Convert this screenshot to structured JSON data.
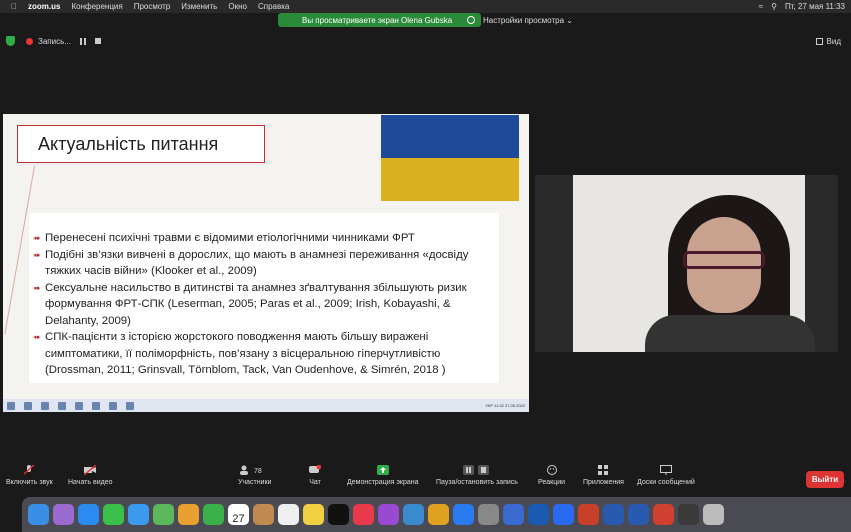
{
  "menubar": {
    "app": "zoom.us",
    "items": [
      "Конференция",
      "Просмотр",
      "Изменить",
      "Окно",
      "Справка"
    ],
    "datetime": "Пт, 27 мая  11:33"
  },
  "share_banner": {
    "text": "Вы просматриваете экран Olena Gubska",
    "view_settings": "Настройки просмотра"
  },
  "recording": {
    "label": "Запись..."
  },
  "view": {
    "label": "Вид"
  },
  "slide": {
    "title": "Актуальність питання",
    "bullets": [
      "Перенесені психічні травми є відомими етіологічними чинниками ФРТ",
      "Подібні зв’язки вивчені в дорослих, що мають в анамнезі переживання «досвіду тяжких часів війни» (Klooker et al., 2009)",
      "Сексуальне насильство в дитинстві та анамнез зґвалтування збільшують ризик формування ФРТ-СПК (Leserman, 2005; Paras et al., 2009; Irish, Kobayashi, & Delahanty, 2009)",
      "СПК-пацієнти з історією жорстокого поводження мають більшу виражені симптоматики, її поліморфність, пов’язану з  вісцеральною гіперчутливістю (Drossman, 2011; Grinsvall, Törnblom, Tack, Van Oudenhove, & Simrén, 2018 )"
    ],
    "taskbar_time": "11:32",
    "taskbar_date": "27.05.2022",
    "taskbar_lang": "УКР"
  },
  "controls": {
    "mute": "Включить звук",
    "video": "Начать видео",
    "participants": "Участники",
    "participants_count": "78",
    "chat": "Чат",
    "chat_badge": "8",
    "share": "Демонстрация экрана",
    "pause_record": "Пауза/остановить запись",
    "reactions": "Реакции",
    "apps": "Приложения",
    "whiteboard": "Доски сообщений",
    "exit": "Выйти"
  },
  "dock": {
    "calendar_day": "27",
    "calendar_month": "МАЯ"
  },
  "colors": {
    "share_green": "#2a8a3a",
    "exit_red": "#d33333",
    "title_border": "#c03030"
  }
}
